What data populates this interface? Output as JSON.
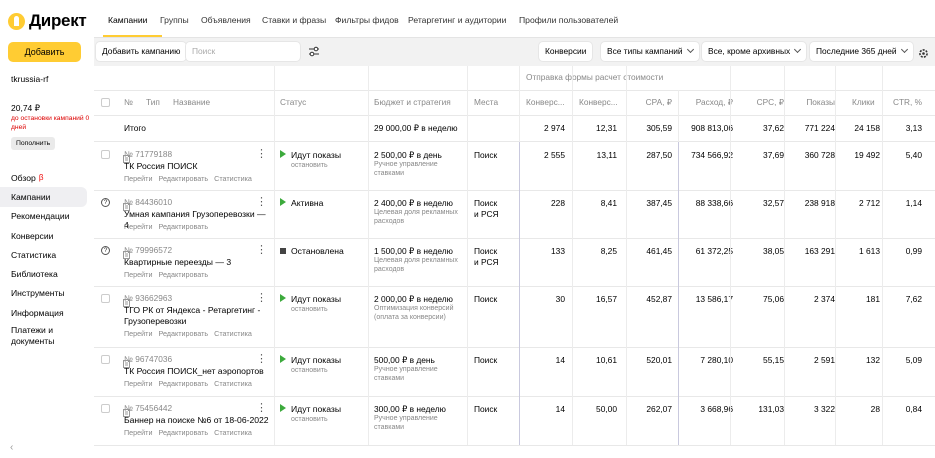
{
  "logo": "Директ",
  "sidebar": {
    "add_button": "Добавить",
    "login": "tkrussia-rf",
    "balance": "20,74 ₽",
    "balance_note": "до остановки кампаний 0 дней",
    "topup": "Пополнить",
    "nav": [
      {
        "label": "Обзор",
        "beta": "β"
      },
      {
        "label": "Кампании"
      },
      {
        "label": "Рекомендации"
      },
      {
        "label": "Конверсии"
      },
      {
        "label": "Статистика"
      },
      {
        "label": "Библиотека"
      },
      {
        "label": "Инструменты"
      },
      {
        "label": "Информация"
      },
      {
        "label": "Платежи и документы"
      }
    ],
    "collapse": "‹"
  },
  "tabs": [
    "Кампании",
    "Группы",
    "Объявления",
    "Ставки и фразы",
    "Фильтры фидов",
    "Ретаргетинг и аудитории",
    "Профили пользователей"
  ],
  "toolbar": {
    "add_campaign": "Добавить кампанию",
    "search_placeholder": "Поиск",
    "conversions": "Конверсии",
    "types": "Все типы кампаний",
    "archive": "Все, кроме архивных",
    "period": "Последние 365 дней"
  },
  "table": {
    "goal_header": "Отправка формы расчет стоимости",
    "headers": {
      "num": "№",
      "type": "Тип",
      "name": "Название",
      "status": "Статус",
      "budget": "Бюджет и стратегия",
      "places": "Места",
      "conv": "Конверс...",
      "convrate": "Конверс...",
      "cpa": "CPA, ₽",
      "spend": "Расход, ₽",
      "cpc": "CPC, ₽",
      "impr": "Показы",
      "clicks": "Клики",
      "ctr": "CTR, %"
    },
    "total": {
      "label": "Итого",
      "budget": "29 000,00 ₽ в неделю",
      "conv": "2 974",
      "convrate": "12,31",
      "cpa": "305,59",
      "spend": "908 813,06",
      "cpc": "37,62",
      "impr": "771 224",
      "clicks": "24 158",
      "ctr": "3,13"
    },
    "links": {
      "go": "Перейти",
      "edit": "Редактировать",
      "stats": "Статистика"
    },
    "rows": [
      {
        "id": "№ 71779188",
        "name": "ТК Россия ПОИСК",
        "status": "Идут показы",
        "status_sub": "остановить",
        "budget": "2 500,00 ₽ в день",
        "strategy": "Ручное управление ставками",
        "places": "Поиск",
        "conv": "2 555",
        "convrate": "13,11",
        "cpa": "287,50",
        "spend": "734 566,92",
        "cpc": "37,69",
        "impr": "360 728",
        "clicks": "19 492",
        "ctr": "5,40",
        "links": 3,
        "kind": "play",
        "q": false
      },
      {
        "id": "№ 84436010",
        "name": "Умная кампания Грузоперевозки — 4",
        "status": "Активна",
        "status_sub": "",
        "budget": "2 400,00 ₽ в неделю",
        "strategy": "Целевая доля рекламных расходов",
        "places": "Поиск и РСЯ",
        "conv": "228",
        "convrate": "8,41",
        "cpa": "387,45",
        "spend": "88 338,66",
        "cpc": "32,57",
        "impr": "238 918",
        "clicks": "2 712",
        "ctr": "1,14",
        "links": 2,
        "kind": "play",
        "q": true
      },
      {
        "id": "№ 79996572",
        "name": "Квартирные переезды — 3",
        "status": "Остановлена",
        "status_sub": "",
        "budget": "1 500,00 ₽ в неделю",
        "strategy": "Целевая доля рекламных расходов",
        "places": "Поиск и РСЯ",
        "conv": "133",
        "convrate": "8,25",
        "cpa": "461,45",
        "spend": "61 372,25",
        "cpc": "38,05",
        "impr": "163 291",
        "clicks": "1 613",
        "ctr": "0,99",
        "links": 2,
        "kind": "stop",
        "q": true
      },
      {
        "id": "№ 93662963",
        "name": "ТГО РК от Яндекса - Ретаргетинг - Грузоперевозки",
        "status": "Идут показы",
        "status_sub": "остановить",
        "budget": "2 000,00 ₽ в неделю",
        "strategy": "Оптимизация конверсий (оплата за конверсии)",
        "places": "Поиск",
        "conv": "30",
        "convrate": "16,57",
        "cpa": "452,87",
        "spend": "13 586,17",
        "cpc": "75,06",
        "impr": "2 374",
        "clicks": "181",
        "ctr": "7,62",
        "links": 3,
        "kind": "play",
        "q": false
      },
      {
        "id": "№ 96747036",
        "name": "ТК Россия ПОИСК_нет аэропортов",
        "status": "Идут показы",
        "status_sub": "остановить",
        "budget": "500,00 ₽ в день",
        "strategy": "Ручное управление ставками",
        "places": "Поиск",
        "conv": "14",
        "convrate": "10,61",
        "cpa": "520,01",
        "spend": "7 280,10",
        "cpc": "55,15",
        "impr": "2 591",
        "clicks": "132",
        "ctr": "5,09",
        "links": 3,
        "kind": "play",
        "q": false
      },
      {
        "id": "№ 75456442",
        "name": "Баннер на поиске №6 от 18-06-2022",
        "status": "Идут показы",
        "status_sub": "остановить",
        "budget": "300,00 ₽ в неделю",
        "strategy": "Ручное управление ставками",
        "places": "Поиск",
        "conv": "14",
        "convrate": "50,00",
        "cpa": "262,07",
        "spend": "3 668,96",
        "cpc": "131,03",
        "impr": "3 322",
        "clicks": "28",
        "ctr": "0,84",
        "links": 3,
        "kind": "play",
        "q": false
      }
    ]
  },
  "colors": {
    "accent": "#ffcc33",
    "play": "#3caa3c",
    "warning": "#dd0000"
  }
}
